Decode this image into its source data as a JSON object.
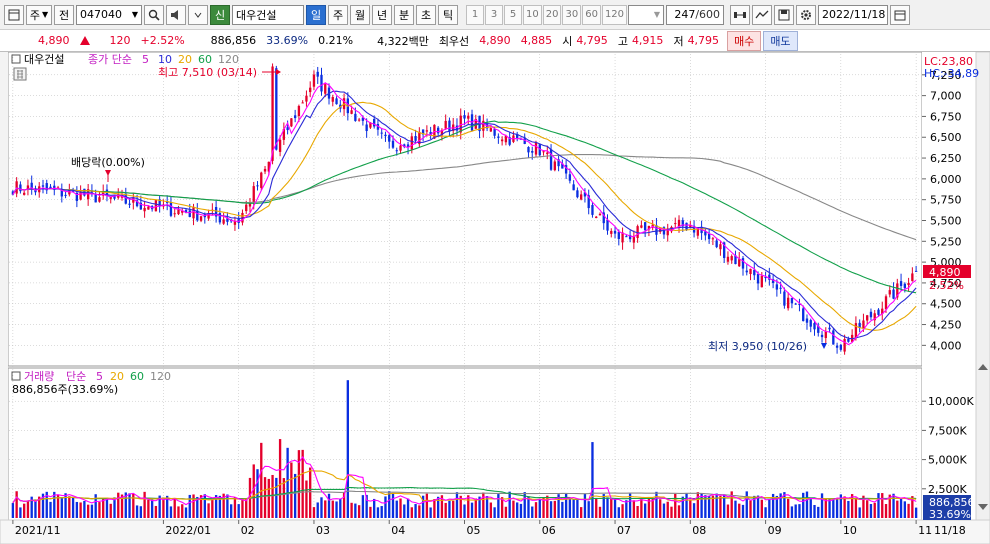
{
  "toolbar": {
    "market": "주",
    "prefix": "전",
    "code": "047040",
    "badge_new": "신",
    "stock_name": "대우건설",
    "periods": [
      "일",
      "주",
      "월",
      "년",
      "분",
      "초",
      "틱"
    ],
    "active_period": "일",
    "tick_steps": [
      "1",
      "3",
      "5",
      "10",
      "20",
      "30",
      "60",
      "120"
    ],
    "bar_count": "247",
    "bar_total": "/600",
    "date": "2022/11/18"
  },
  "quote": {
    "price": "4,890",
    "change": "120",
    "change_pct": "+2.52%",
    "volume": "886,856",
    "volume_ratio": "33.69%",
    "turnover": "0.21%",
    "trade_value": "4,322백만",
    "best_bid_label": "최우선",
    "best_ask": "4,890",
    "best_bid": "4,885",
    "open_label": "시",
    "open": "4,795",
    "high_label": "고",
    "high": "4,915",
    "low_label": "저",
    "low": "4,795",
    "buy_label": "매수",
    "sell_label": "매도"
  },
  "price_panel": {
    "legend_name": "대우건설",
    "legend_ma_title": "종가 단순",
    "legend_ma": [
      "5",
      "10",
      "20",
      "60",
      "120"
    ],
    "lc": "LC:23,80",
    "hc": "HC:-34,89",
    "y_ticks": [
      "7,250",
      "7,000",
      "6,750",
      "6,500",
      "6,250",
      "6,000",
      "5,750",
      "5,500",
      "5,250",
      "5,000",
      "4,750",
      "4,500",
      "4,250",
      "4,000"
    ],
    "current_price_tag": "4,890",
    "current_pct_tag": "2.52%",
    "high_annotation": "최고 7,510 (03/14)",
    "low_annotation": "최저 3,950 (10/26)",
    "dividend_annotation": "배당락(0.00%)"
  },
  "volume_panel": {
    "legend_title": "거래량",
    "legend_ma_title": "단순",
    "legend_ma": [
      "5",
      "20",
      "60",
      "120"
    ],
    "current_text": "886,856주(33.69%)",
    "y_ticks": [
      "10,000K",
      "7,500K",
      "5,000K",
      "2,500K"
    ],
    "current_tag": "886,856",
    "current_pct": "33.69%"
  },
  "x_axis": {
    "labels": [
      "2021/11",
      "2022/01",
      "02",
      "03",
      "04",
      "05",
      "06",
      "07",
      "08",
      "09",
      "10",
      "11"
    ],
    "right_label": "11/18"
  },
  "colors": {
    "up": "#e4002b",
    "down": "#0a2ee0",
    "ma5": "#ff00ff",
    "ma10": "#2b2bd6",
    "ma20": "#e8a800",
    "ma60": "#12a04a",
    "ma120": "#888888",
    "grid": "#b8b8b8"
  },
  "chart_data": {
    "type": "candlestick",
    "title": "대우건설",
    "price_axis_range": [
      3800,
      7500
    ],
    "volume_axis_range": [
      0,
      12500000
    ],
    "anchors": [
      {
        "date": "2021/11",
        "close": 5900
      },
      {
        "date": "2021/12",
        "close": 5800
      },
      {
        "date": "2022/01",
        "close": 5650
      },
      {
        "date": "2022/02",
        "close": 5500
      },
      {
        "date": "2022/03",
        "close": 7200
      },
      {
        "date": "2022/04",
        "close": 6400
      },
      {
        "date": "2022/05",
        "close": 6700
      },
      {
        "date": "2022/06",
        "close": 6350
      },
      {
        "date": "2022/07",
        "close": 5300
      },
      {
        "date": "2022/08",
        "close": 5450
      },
      {
        "date": "2022/09",
        "close": 4750
      },
      {
        "date": "2022/10",
        "close": 4000
      },
      {
        "date": "2022/11",
        "close": 4890
      }
    ],
    "high": {
      "value": 7510,
      "date": "03/14"
    },
    "low": {
      "value": 3950,
      "date": "10/26"
    },
    "last": {
      "close": 4890,
      "volume": 886856
    }
  }
}
